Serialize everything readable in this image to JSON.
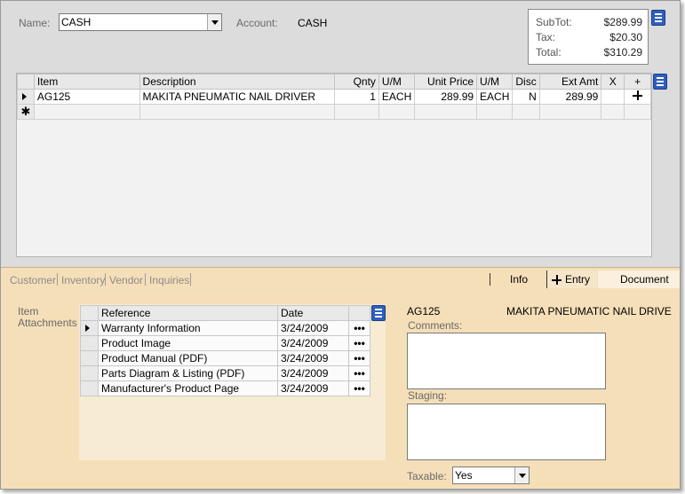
{
  "header": {
    "name_label": "Name:",
    "name_value": "CASH",
    "account_label": "Account:",
    "account_value": "CASH"
  },
  "totals": {
    "subtotal_label": "SubTot:",
    "subtotal_value": "$289.99",
    "tax_label": "Tax:",
    "tax_value": "$20.30",
    "total_label": "Total:",
    "total_value": "$310.29"
  },
  "grid": {
    "columns": [
      "Item",
      "Description",
      "Qnty",
      "U/M",
      "Unit Price",
      "U/M",
      "Disc",
      "Ext Amt",
      "X",
      "+"
    ],
    "rows": [
      {
        "item": "AG125",
        "description": "MAKITA PNEUMATIC NAIL DRIVER",
        "qnty": "1",
        "um": "EACH",
        "unit_price": "289.99",
        "price_um": "EACH",
        "disc": "N",
        "ext_amt": "289.99"
      }
    ],
    "new_row_marker": "✱"
  },
  "left_tabs": [
    "Customer",
    "Inventory",
    "Vendor",
    "Inquiries"
  ],
  "right_tabs": {
    "info": "Info",
    "entry": "Entry",
    "document": "Document"
  },
  "attachments": {
    "section_label_line1": "Item",
    "section_label_line2": "Attachments",
    "columns": [
      "Reference",
      "Date"
    ],
    "rows": [
      {
        "reference": "Warranty Information",
        "date": "3/24/2009",
        "action": "•••"
      },
      {
        "reference": "Product Image",
        "date": "3/24/2009",
        "action": "•••"
      },
      {
        "reference": "Product Manual (PDF)",
        "date": "3/24/2009",
        "action": "•••"
      },
      {
        "reference": "Parts Diagram & Listing (PDF)",
        "date": "3/24/2009",
        "action": "•••"
      },
      {
        "reference": "Manufacturer's Product Page",
        "date": "3/24/2009",
        "action": "•••"
      }
    ]
  },
  "detail": {
    "item_code": "AG125",
    "item_description": "MAKITA PNEUMATIC NAIL DRIVE",
    "comments_label": "Comments:",
    "comments_value": "",
    "staging_label": "Staging:",
    "staging_value": "",
    "taxable_label": "Taxable:",
    "taxable_value": "Yes"
  },
  "colors": {
    "panel_bg": "#dcdcdc",
    "bottom_bg": "#f5dfb8",
    "menu_icon": "#2e5fbf"
  },
  "icons": [
    "menu-icon",
    "row-selector-icon",
    "add-line-icon",
    "new-row-icon",
    "dropdown-arrow-icon",
    "plus-icon"
  ]
}
